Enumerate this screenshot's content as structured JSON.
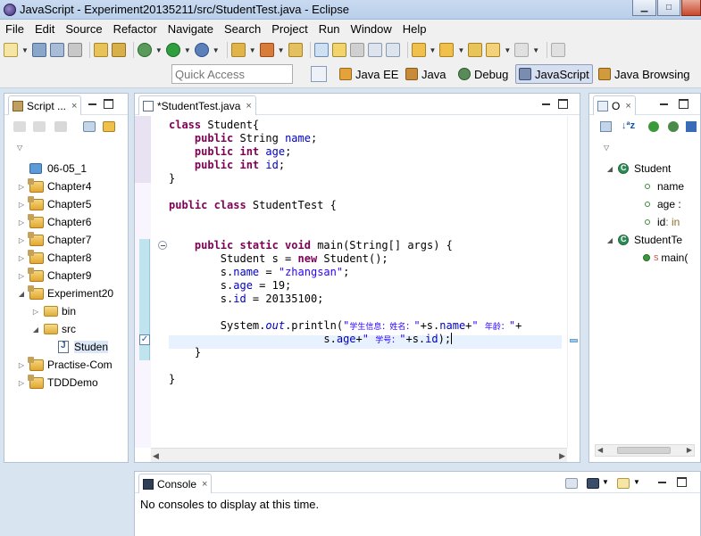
{
  "window": {
    "title": "JavaScript - Experiment20135211/src/StudentTest.java - Eclipse"
  },
  "menu": [
    "File",
    "Edit",
    "Source",
    "Refactor",
    "Navigate",
    "Search",
    "Project",
    "Run",
    "Window",
    "Help"
  ],
  "quick_access": {
    "placeholder": "Quick Access"
  },
  "perspectives": [
    {
      "label": "Java EE",
      "icon": "java-ee-icon",
      "active": false
    },
    {
      "label": "Java",
      "icon": "java-icon",
      "active": false
    },
    {
      "label": "Debug",
      "icon": "debug-icon",
      "active": false
    },
    {
      "label": "JavaScript",
      "icon": "javascript-icon",
      "active": true
    },
    {
      "label": "Java Browsing",
      "icon": "java-browsing-icon",
      "active": false
    }
  ],
  "explorer": {
    "tab_label": "Script ...",
    "tree": [
      {
        "label": "06-05_1",
        "icon": "blue-folder-icon",
        "depth": 0,
        "expanded": null
      },
      {
        "label": "Chapter4",
        "icon": "project-icon",
        "depth": 0,
        "expanded": false
      },
      {
        "label": "Chapter5",
        "icon": "project-icon",
        "depth": 0,
        "expanded": false
      },
      {
        "label": "Chapter6",
        "icon": "project-icon",
        "depth": 0,
        "expanded": false
      },
      {
        "label": "Chapter7",
        "icon": "project-icon",
        "depth": 0,
        "expanded": false
      },
      {
        "label": "Chapter8",
        "icon": "project-icon",
        "depth": 0,
        "expanded": false
      },
      {
        "label": "Chapter9",
        "icon": "project-icon",
        "depth": 0,
        "expanded": false
      },
      {
        "label": "Experiment20",
        "icon": "project-icon",
        "depth": 0,
        "expanded": true
      },
      {
        "label": "bin",
        "icon": "folder-icon",
        "depth": 1,
        "expanded": false
      },
      {
        "label": "src",
        "icon": "folder-icon",
        "depth": 1,
        "expanded": true
      },
      {
        "label": "Studen",
        "icon": "java-file-icon",
        "depth": 2,
        "expanded": null,
        "selected": true
      },
      {
        "label": "Practise-Com",
        "icon": "project-icon",
        "depth": 0,
        "expanded": false
      },
      {
        "label": "TDDDemo",
        "icon": "project-icon",
        "depth": 0,
        "expanded": false
      }
    ]
  },
  "editor": {
    "tab_label": "*StudentTest.java",
    "code_lines": [
      [
        {
          "t": "class ",
          "c": "kw"
        },
        {
          "t": "Student{",
          "c": ""
        }
      ],
      [
        {
          "t": "    ",
          "c": ""
        },
        {
          "t": "public ",
          "c": "kw"
        },
        {
          "t": "String ",
          "c": ""
        },
        {
          "t": "name",
          "c": "fld"
        },
        {
          "t": ";",
          "c": ""
        }
      ],
      [
        {
          "t": "    ",
          "c": ""
        },
        {
          "t": "public int ",
          "c": "kw"
        },
        {
          "t": "age",
          "c": "fld"
        },
        {
          "t": ";",
          "c": ""
        }
      ],
      [
        {
          "t": "    ",
          "c": ""
        },
        {
          "t": "public int ",
          "c": "kw"
        },
        {
          "t": "id",
          "c": "fld"
        },
        {
          "t": ";",
          "c": ""
        }
      ],
      [
        {
          "t": "}",
          "c": ""
        }
      ],
      [],
      [
        {
          "t": "public class ",
          "c": "kw"
        },
        {
          "t": "StudentTest {",
          "c": ""
        }
      ],
      [],
      [],
      [
        {
          "t": "    ",
          "c": ""
        },
        {
          "t": "public static void ",
          "c": "kw"
        },
        {
          "t": "main(String[] args) {",
          "c": ""
        }
      ],
      [
        {
          "t": "        Student s = ",
          "c": ""
        },
        {
          "t": "new ",
          "c": "kw"
        },
        {
          "t": "Student();",
          "c": ""
        }
      ],
      [
        {
          "t": "        s.",
          "c": ""
        },
        {
          "t": "name",
          "c": "fld"
        },
        {
          "t": " = ",
          "c": ""
        },
        {
          "t": "\"zhangsan\"",
          "c": "str"
        },
        {
          "t": ";",
          "c": ""
        }
      ],
      [
        {
          "t": "        s.",
          "c": ""
        },
        {
          "t": "age",
          "c": "fld"
        },
        {
          "t": " = 19;",
          "c": ""
        }
      ],
      [
        {
          "t": "        s.",
          "c": ""
        },
        {
          "t": "id",
          "c": "fld"
        },
        {
          "t": " = 20135100;",
          "c": ""
        }
      ],
      [],
      [
        {
          "t": "        System.",
          "c": ""
        },
        {
          "t": "out",
          "c": "stat"
        },
        {
          "t": ".println(",
          "c": ""
        },
        {
          "t": "\"",
          "c": "str"
        },
        {
          "t": "学生信息：姓名：",
          "c": "cn-str"
        },
        {
          "t": "\"",
          "c": "str"
        },
        {
          "t": "+s.",
          "c": ""
        },
        {
          "t": "name",
          "c": "fld"
        },
        {
          "t": "+",
          "c": ""
        },
        {
          "t": "\" ",
          "c": "str"
        },
        {
          "t": "年龄：",
          "c": "cn-str"
        },
        {
          "t": "\"",
          "c": "str"
        },
        {
          "t": "+",
          "c": ""
        }
      ],
      [
        {
          "t": "                        s.",
          "c": ""
        },
        {
          "t": "age",
          "c": "fld"
        },
        {
          "t": "+",
          "c": ""
        },
        {
          "t": "\" ",
          "c": "str"
        },
        {
          "t": "学号：",
          "c": "cn-str"
        },
        {
          "t": "\"",
          "c": "str"
        },
        {
          "t": "+s.",
          "c": ""
        },
        {
          "t": "id",
          "c": "fld"
        },
        {
          "t": ");",
          "c": ""
        },
        {
          "t": "|caret|",
          "c": "caret"
        }
      ],
      [
        {
          "t": "    }",
          "c": ""
        }
      ],
      [],
      [
        {
          "t": "}",
          "c": ""
        }
      ]
    ]
  },
  "outline": {
    "tab_label": "O",
    "items": [
      {
        "label": "Student",
        "kind": "class",
        "depth": 0,
        "expanded": true
      },
      {
        "label": "name",
        "kind": "field",
        "depth": 1,
        "type": ""
      },
      {
        "label": "age :",
        "kind": "field",
        "depth": 1,
        "type": ""
      },
      {
        "label": "id",
        "kind": "field",
        "depth": 1,
        "type": ": in"
      },
      {
        "label": "StudentTe",
        "kind": "class",
        "depth": 0,
        "expanded": true
      },
      {
        "label": "main(",
        "kind": "method",
        "depth": 1,
        "modifier": "S"
      }
    ]
  },
  "console": {
    "tab_label": "Console",
    "message": "No consoles to display at this time."
  }
}
